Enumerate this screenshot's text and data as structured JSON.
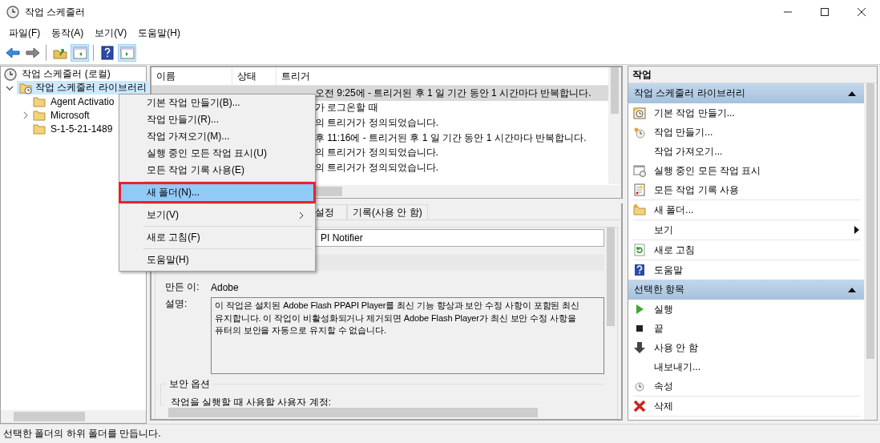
{
  "window": {
    "title": "작업 스케줄러"
  },
  "menu_bar": [
    "파일(F)",
    "동작(A)",
    "보기(V)",
    "도움말(H)"
  ],
  "toolbar": [
    {
      "kind": "back",
      "on": false
    },
    {
      "kind": "forward",
      "on": false
    },
    {
      "kind": "separator"
    },
    {
      "kind": "folder",
      "on": false
    },
    {
      "kind": "pane-left",
      "on": true
    },
    {
      "kind": "separator"
    },
    {
      "kind": "help",
      "on": false
    },
    {
      "kind": "pane-right",
      "on": true
    }
  ],
  "tree": {
    "label": "작업 스케줄러 (로컬)",
    "selected": false,
    "children": [
      {
        "label": "작업 스케줄러 라이브러리",
        "expanded": true,
        "selected": true,
        "children": [
          {
            "label": "Agent Activatio",
            "selected": false
          },
          {
            "label": "Microsoft",
            "expanded": false,
            "selected": false
          },
          {
            "label": "S-1-5-21-1489",
            "selected": false
          }
        ]
      }
    ]
  },
  "task_table": {
    "columns": [
      "이름",
      "상태",
      "트리거"
    ],
    "rows": [
      {
        "trigger": "오전 9:25에 - 트리거된 후 1 일 기간 동안 1 시간마다 반복합니다.",
        "selected": true
      },
      {
        "trigger": "가 로그온할 때",
        "selected": false
      },
      {
        "trigger": "의 트리거가 정의되었습니다.",
        "selected": false
      },
      {
        "trigger": "후 11:16에 - 트리거된 후 1 일 기간 동안 1 시간마다 반복합니다.",
        "selected": false
      },
      {
        "trigger": "의 트리거가 정의되었습니다.",
        "selected": false
      },
      {
        "trigger": "의 트리거가 정의되었습니다.",
        "selected": false
      }
    ]
  },
  "detail": {
    "tabs": [
      {
        "label": "설정",
        "selected": false
      },
      {
        "label": "기록(사용 안 함)",
        "selected": false
      }
    ],
    "name_value": "PI Notifier",
    "author_label": "만든 이:",
    "author": "Adobe",
    "description_label": "설명:",
    "description_lines": [
      "이 작업은 설치된 Adobe Flash PPAPI Player를 최신 기능 향상과 보안 수정 사항이 포함된 최신",
      "유지합니다. 이 작업이 비활성화되거나 제거되면 Adobe Flash Player가 최신 보안 수정 사항을",
      "퓨터의 보안을 자동으로 유지할 수 없습니다."
    ],
    "security_group": "보안 옵션",
    "account_label": "작업을 실행할 때 사용할 사용자 계정:"
  },
  "context_menu": {
    "items": [
      {
        "kind": "item",
        "label": "기본 작업 만들기(B)...",
        "selected": false
      },
      {
        "kind": "item",
        "label": "작업 만들기(R)...",
        "selected": false
      },
      {
        "kind": "item",
        "label": "작업 가져오기(M)...",
        "selected": false
      },
      {
        "kind": "item",
        "label": "실행 중인 모든 작업 표시(U)",
        "selected": false
      },
      {
        "kind": "item",
        "label": "모든 작업 기록 사용(E)",
        "selected": false
      },
      {
        "kind": "separator"
      },
      {
        "kind": "item",
        "label": "새 폴더(N)...",
        "selected": true,
        "outlined": true
      },
      {
        "kind": "separator"
      },
      {
        "kind": "submenu",
        "label": "보기(V)",
        "selected": false
      },
      {
        "kind": "separator"
      },
      {
        "kind": "item",
        "label": "새로 고침(F)",
        "selected": false
      },
      {
        "kind": "separator"
      },
      {
        "kind": "item",
        "label": "도움말(H)",
        "selected": false
      }
    ]
  },
  "actions_pane": {
    "title": "작업",
    "sections": [
      {
        "title": "작업 스케줄러 라이브러리",
        "expanded": true,
        "items": [
          {
            "kind": "basic-task",
            "label": "기본 작업 만들기..."
          },
          {
            "kind": "create-task",
            "label": "작업 만들기..."
          },
          {
            "kind": "plain",
            "label": "작업 가져오기..."
          },
          {
            "kind": "running",
            "label": "실행 중인 모든 작업 표시"
          },
          {
            "kind": "history",
            "label": "모든 작업 기록 사용"
          },
          {
            "kind": "separator"
          },
          {
            "kind": "folder",
            "label": "새 폴더..."
          },
          {
            "kind": "separator"
          },
          {
            "kind": "submenu",
            "label": "보기"
          },
          {
            "kind": "separator"
          },
          {
            "kind": "refresh",
            "label": "새로 고침"
          },
          {
            "kind": "separator"
          },
          {
            "kind": "help",
            "label": "도움말"
          }
        ]
      },
      {
        "title": "선택한 항목",
        "expanded": true,
        "items": [
          {
            "kind": "run",
            "label": "실행"
          },
          {
            "kind": "end",
            "label": "끝"
          },
          {
            "kind": "disable",
            "label": "사용 안 함"
          },
          {
            "kind": "plain",
            "label": "내보내기..."
          },
          {
            "kind": "properties",
            "label": "속성"
          },
          {
            "kind": "separator"
          },
          {
            "kind": "delete",
            "label": "삭제"
          },
          {
            "kind": "separator"
          }
        ]
      }
    ]
  },
  "status_bar": {
    "text": "선택한 폴더의 하위 폴더를 만듭니다."
  }
}
